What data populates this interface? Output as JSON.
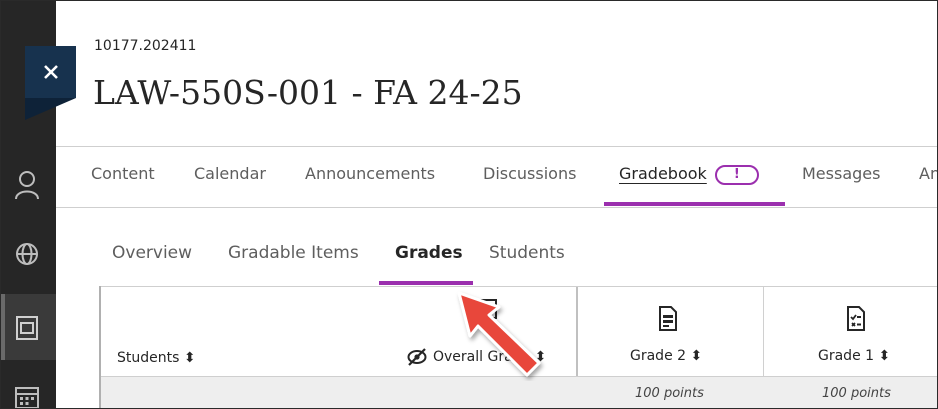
{
  "course": {
    "id": "10177.202411",
    "title": "LAW-550S-001 - FA 24-25"
  },
  "close": {
    "icon": "close-icon"
  },
  "sidebar": {
    "icons": [
      "user-icon",
      "globe-icon",
      "courses-icon",
      "calendar-icon"
    ]
  },
  "tabs": [
    {
      "label": "Content"
    },
    {
      "label": "Calendar"
    },
    {
      "label": "Announcements"
    },
    {
      "label": "Discussions"
    },
    {
      "label": "Gradebook",
      "badge": "!"
    },
    {
      "label": "Messages"
    },
    {
      "label": "An"
    }
  ],
  "subtabs": [
    {
      "label": "Overview"
    },
    {
      "label": "Gradable Items"
    },
    {
      "label": "Grades"
    },
    {
      "label": "Students"
    }
  ],
  "grid": {
    "students_header": "Students ⬍",
    "overall_grade_header": "Overall Grade ⬍",
    "columns": [
      {
        "label": "Grade 2 ⬍",
        "points": "100 points"
      },
      {
        "label": "Grade 1 ⬍",
        "points": "100 points"
      }
    ]
  },
  "colors": {
    "accent": "#9b2fae",
    "close_bg": "#17324e",
    "sidebar_bg": "#262626",
    "arrow": "#e8473a"
  }
}
